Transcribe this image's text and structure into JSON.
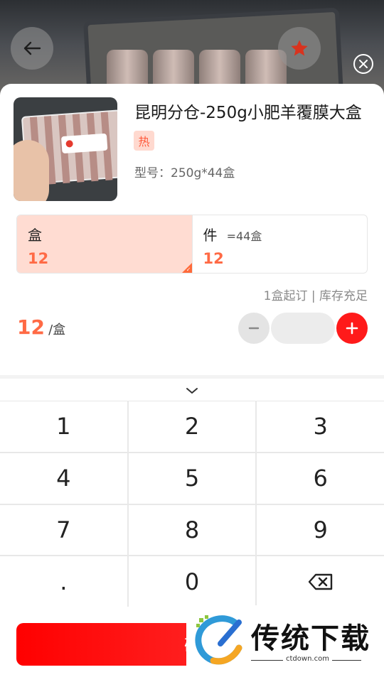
{
  "product": {
    "title": "昆明分仓-250g小肥羊覆膜大盒",
    "tag": "热",
    "model": "型号：250g*44盒"
  },
  "units": [
    {
      "name": "盒",
      "conversion": "",
      "price": "12",
      "selected": true
    },
    {
      "name": "件",
      "conversion": "=44盒",
      "price": "12",
      "selected": false
    }
  ],
  "stock_info": "1盒起订 | 库存充足",
  "price": {
    "value": "12",
    "unit": "/盒"
  },
  "quantity": {
    "value": ""
  },
  "keypad": {
    "keys": [
      "1",
      "2",
      "3",
      "4",
      "5",
      "6",
      "7",
      "8",
      "9",
      ".",
      "0"
    ]
  },
  "confirm": {
    "label": "确"
  },
  "watermark": {
    "brand": "传统下载",
    "domain": "ctdown.com"
  },
  "colors": {
    "accent": "#ff6a45",
    "primary": "#ff1a1a",
    "selected_bg": "#ffdcd2"
  },
  "icons": {
    "back": "arrow-left-icon",
    "favorite": "star-icon",
    "close": "close-circle-icon",
    "collapse": "chevron-down-icon",
    "backspace": "backspace-icon"
  }
}
